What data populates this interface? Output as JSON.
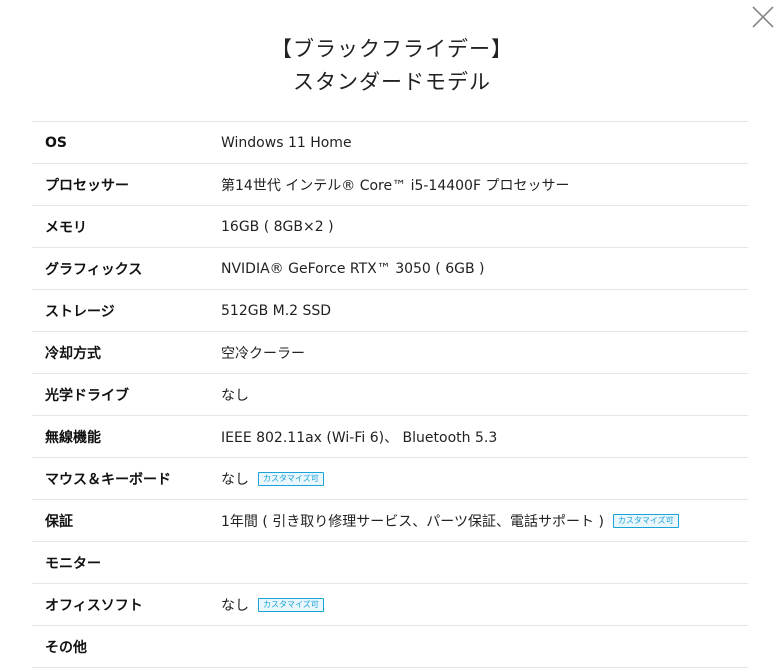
{
  "dialog": {
    "title_line1": "【ブラックフライデー】",
    "title_line2": "スタンダードモデル",
    "close_icon": "close-x-icon"
  },
  "badge_label": "カスタマイズ可",
  "colors": {
    "badge": "#1aa3d9",
    "divider": "#e6e6e6"
  },
  "specs": [
    {
      "label": "OS",
      "value": "Windows 11 Home"
    },
    {
      "label": "プロセッサー",
      "value": "第14世代 インテル® Core™ i5-14400F プロセッサー"
    },
    {
      "label": "メモリ",
      "value": "16GB ( 8GB×2 )"
    },
    {
      "label": "グラフィックス",
      "value": "NVIDIA® GeForce RTX™ 3050 ( 6GB )"
    },
    {
      "label": "ストレージ",
      "value": "512GB M.2 SSD"
    },
    {
      "label": "冷却方式",
      "value": "空冷クーラー"
    },
    {
      "label": "光学ドライブ",
      "value": "なし"
    },
    {
      "label": "無線機能",
      "value": "IEEE 802.11ax (Wi-Fi 6)、 Bluetooth 5.3"
    },
    {
      "label": "マウス＆キーボード",
      "value": "なし"
    },
    {
      "label": "保証",
      "value": "1年間 ( 引き取り修理サービス、パーツ保証、電話サポート )"
    },
    {
      "label": "モニター",
      "value": ""
    },
    {
      "label": "オフィスソフト",
      "value": "なし"
    },
    {
      "label": "その他",
      "value": ""
    }
  ]
}
